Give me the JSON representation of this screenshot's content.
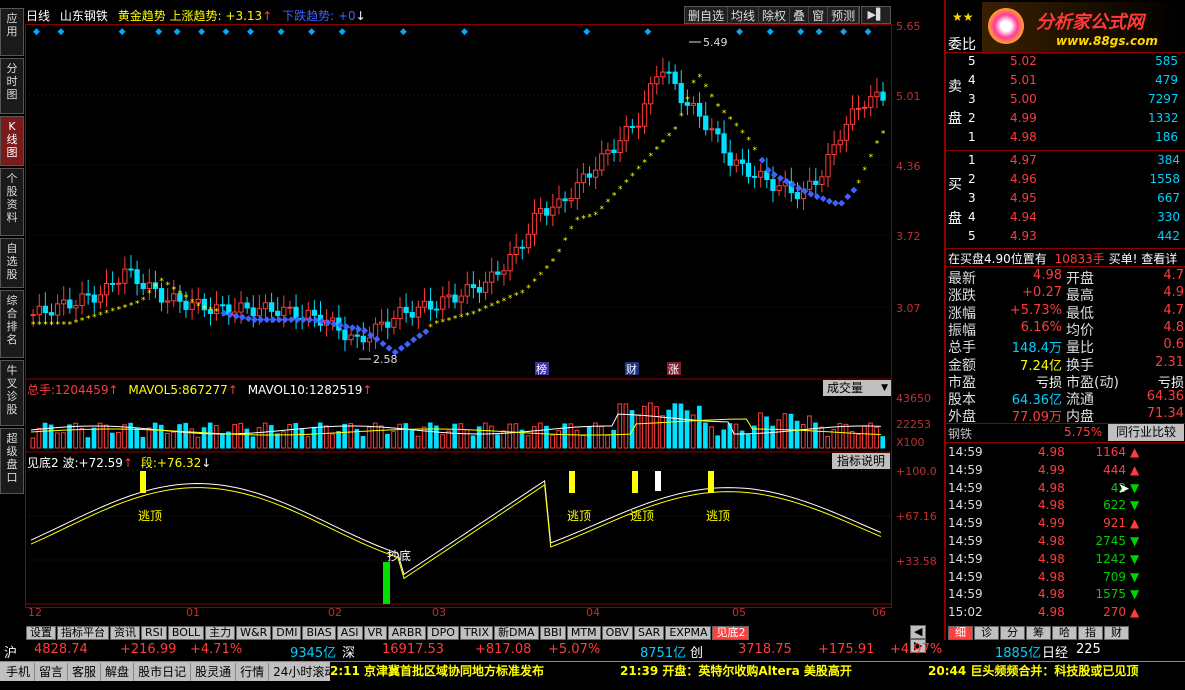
{
  "header": {
    "period": "日线",
    "stock": "山东钢铁",
    "indicator": "黄金趋势",
    "up_label": "上涨趋势:",
    "up_value": "+3.13",
    "down_label": "下跌趋势:",
    "down_value": "+0",
    "buttons": [
      "删自选",
      "均线",
      "除权",
      "叠",
      "窗",
      "预测"
    ]
  },
  "left_tabs": [
    "应\n用",
    "分\n时\n图",
    "K\n线\n图",
    "个\n股\n资\n料",
    "自\n选\n股",
    "综\n合\n排\n名",
    "牛\n叉\n诊\n股",
    "超\n级\n盘\n口"
  ],
  "price_axis": [
    "5.65",
    "5.01",
    "4.36",
    "3.72",
    "3.07"
  ],
  "annotations": {
    "high": "5.49",
    "low": "2.58",
    "badge1": "榜",
    "badge2": "财",
    "badge3": "涨"
  },
  "volume": {
    "total_label": "总手:",
    "total": "1204459",
    "mavol5_label": "MAVOL5:",
    "mavol5": "867277",
    "mavol10_label": "MAVOL10:",
    "mavol10": "1282519",
    "dropdown": "成交量",
    "axis": [
      "43650",
      "22253",
      "X100"
    ]
  },
  "indicator2": {
    "name": "见底2",
    "wave_label": "波:",
    "wave": "+72.59",
    "seg_label": "段:",
    "seg": "+76.32",
    "help": "指标说明",
    "axis": [
      "+100.0",
      "+67.16",
      "+33.58"
    ],
    "labels": [
      "逃顶",
      "逃顶",
      "逃顶",
      "逃顶",
      "抄底"
    ]
  },
  "date_axis": [
    "12",
    "01",
    "02",
    "03",
    "04",
    "05",
    "06"
  ],
  "bottom_tabs": [
    "设置",
    "指标平台",
    "资讯",
    "RSI",
    "BOLL",
    "主力",
    "W&R",
    "DMI",
    "BIAS",
    "ASI",
    "VR",
    "ARBR",
    "DPO",
    "TRIX",
    "新DMA",
    "BBI",
    "MTM",
    "OBV",
    "SAR",
    "EXPMA",
    "见底2"
  ],
  "right_bottom_tabs": [
    "细",
    "诊",
    "分",
    "筹",
    "哈",
    "指",
    "财"
  ],
  "ticker": {
    "sh": "沪",
    "sh_val": "4828.74",
    "sh_chg": "+216.99",
    "sh_pct": "+4.71%",
    "sh_amt": "9345亿",
    "sz": "深",
    "sz_val": "16917.53",
    "sz_chg": "+817.08",
    "sz_pct": "+5.07%",
    "sz_amt": "8751亿",
    "cy": "创",
    "cy_val": "3718.75",
    "cy_chg": "+175.91",
    "cy_pct": "+4.97%",
    "cy_amt": "1885亿",
    "jp": "日经",
    "jp_val": "225"
  },
  "statusbar": {
    "buttons": [
      "手机",
      "留言",
      "客服",
      "解盘",
      "股市日记",
      "股灵通",
      "行情",
      "24小时滚动"
    ],
    "news1": "2:11 京津冀首批区域协同地方标准发布",
    "news2": "21:39 开盘：英特尔收购Altera 美股高开",
    "news3": "20:44 巨头频频合并：科技股或已见顶"
  },
  "logo": {
    "text": "分析家公式网",
    "url": "www.88gs.com"
  },
  "orderbook": {
    "title": "委比",
    "sell_label": [
      "卖",
      "盘"
    ],
    "buy_label": [
      "买",
      "盘"
    ],
    "sells": [
      {
        "n": "5",
        "p": "5.02",
        "v": "585"
      },
      {
        "n": "4",
        "p": "5.01",
        "v": "479"
      },
      {
        "n": "3",
        "p": "5.00",
        "v": "7297"
      },
      {
        "n": "2",
        "p": "4.99",
        "v": "1332"
      },
      {
        "n": "1",
        "p": "4.98",
        "v": "186"
      }
    ],
    "buys": [
      {
        "n": "1",
        "p": "4.97",
        "v": "384"
      },
      {
        "n": "2",
        "p": "4.96",
        "v": "1558"
      },
      {
        "n": "3",
        "p": "4.95",
        "v": "667"
      },
      {
        "n": "4",
        "p": "4.94",
        "v": "330"
      },
      {
        "n": "5",
        "p": "4.93",
        "v": "442"
      }
    ],
    "status": "在买盘4.90位置有",
    "status_vol": "10833手",
    "status_action": "买单!",
    "status_more": "查看详"
  },
  "quote": [
    {
      "l": "最新",
      "v": "4.98",
      "l2": "开盘",
      "v2": "4.7"
    },
    {
      "l": "涨跌",
      "v": "+0.27",
      "l2": "最高",
      "v2": "4.9"
    },
    {
      "l": "涨幅",
      "v": "+5.73%",
      "l2": "最低",
      "v2": "4.7"
    },
    {
      "l": "振幅",
      "v": "6.16%",
      "l2": "均价",
      "v2": "4.8"
    },
    {
      "l": "总手",
      "v": "148.4万",
      "l2": "量比",
      "v2": "0.6"
    },
    {
      "l": "金额",
      "v": "7.24亿",
      "l2": "换手",
      "v2": "2.31"
    },
    {
      "l": "市盈",
      "v": "亏损",
      "l2": "市盈(动)",
      "v2": "亏损"
    },
    {
      "l": "股本",
      "v": "64.36亿",
      "l2": "流通",
      "v2": "64.36"
    },
    {
      "l": "外盘",
      "v": "77.09万",
      "l2": "内盘",
      "v2": "71.34"
    }
  ],
  "industry": {
    "name": "钢铁",
    "pct": "5.75%",
    "btn": "同行业比较"
  },
  "ticks": [
    {
      "t": "14:59",
      "p": "4.98",
      "v": "1164",
      "d": "up"
    },
    {
      "t": "14:59",
      "p": "4.99",
      "v": "444",
      "d": "up"
    },
    {
      "t": "14:59",
      "p": "4.98",
      "v": "42",
      "d": "down"
    },
    {
      "t": "14:59",
      "p": "4.98",
      "v": "622",
      "d": "down"
    },
    {
      "t": "14:59",
      "p": "4.99",
      "v": "921",
      "d": "up"
    },
    {
      "t": "14:59",
      "p": "4.98",
      "v": "2745",
      "d": "down"
    },
    {
      "t": "14:59",
      "p": "4.98",
      "v": "1242",
      "d": "down"
    },
    {
      "t": "14:59",
      "p": "4.98",
      "v": "709",
      "d": "down"
    },
    {
      "t": "14:59",
      "p": "4.98",
      "v": "1575",
      "d": "down"
    },
    {
      "t": "15:02",
      "p": "4.98",
      "v": "270",
      "d": "up"
    }
  ],
  "colors": {
    "up": "#ff3c3c",
    "down": "#00e0ff",
    "ma": "#ffff00",
    "dots": "#4060ff",
    "frame": "#8b0000"
  }
}
